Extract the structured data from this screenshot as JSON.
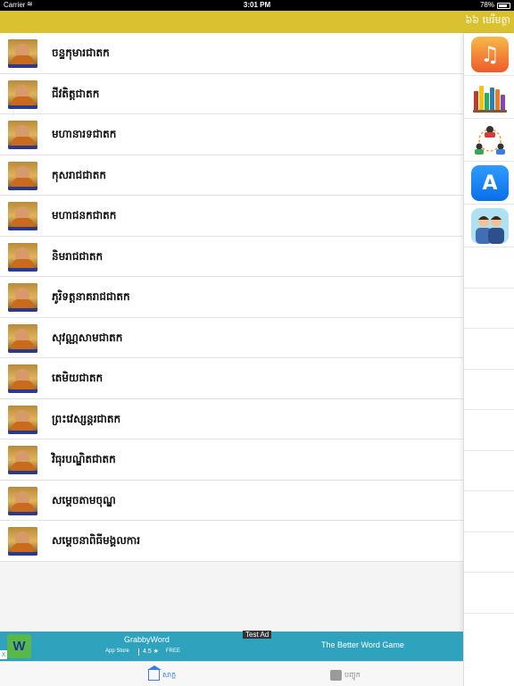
{
  "status_bar": {
    "carrier": "Carrier",
    "time": "3:01 PM",
    "battery": "78%"
  },
  "nav": {
    "menu_title": "៦៦ មេរឹមត្ថា"
  },
  "list": {
    "items": [
      {
        "title": "ចន្ទកុមារជាតក"
      },
      {
        "title": "ជីវតិត្តជាតក"
      },
      {
        "title": "មហានារទជាតក"
      },
      {
        "title": "កុសរាជជាតក"
      },
      {
        "title": "មហាជនកជាតក"
      },
      {
        "title": "និមរាជជាតក"
      },
      {
        "title": "ភូរិទត្តនាគរាជជាតក"
      },
      {
        "title": "សុវណ្ណសាមជាតក"
      },
      {
        "title": "តេមិយជាតក"
      },
      {
        "title": "ព្រះវេស្សន្តរជាតក"
      },
      {
        "title": "វិធុរបណ្ឌិតជាតក"
      },
      {
        "title": "សម្ដេចតាមចុណ្ឌ"
      },
      {
        "title": "សម្ដេចនាពិធីមង្គលការ"
      }
    ]
  },
  "sidebar": {
    "items": [
      {
        "icon": "music-icon"
      },
      {
        "icon": "books-icon"
      },
      {
        "icon": "network-icon"
      },
      {
        "icon": "app-store-icon"
      },
      {
        "icon": "people-icon"
      }
    ]
  },
  "ad": {
    "logo": "W",
    "close": "X",
    "app_name": "GrabbyWord",
    "store": "App Store",
    "rating": "4.5 ★",
    "price": "FREE",
    "test_label": "Test Ad",
    "tagline": "The Better Word Game"
  },
  "tabs": {
    "home_label": "សាក្ត",
    "books_label": "បញ្ចូក"
  },
  "colors": {
    "nav_bar": "#d9c12f",
    "ad_background": "#2fa3bd",
    "tab_active": "#3a7be8"
  }
}
